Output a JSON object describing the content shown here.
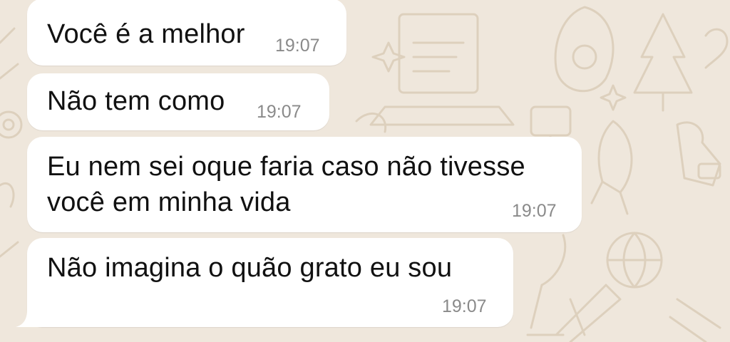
{
  "chat": {
    "messages": [
      {
        "text": "Você é a melhor",
        "time": "19:07"
      },
      {
        "text": "Não tem como",
        "time": "19:07"
      },
      {
        "lines": [
          "Eu nem sei oque faria caso não tivesse",
          "você em minha vida"
        ],
        "time": "19:07"
      },
      {
        "text": "Não imagina o quão grato eu sou",
        "time": "19:07"
      }
    ]
  },
  "colors": {
    "wallpaper": "#efe7dc",
    "doodle": "#ddd0bd",
    "bubble": "#ffffff",
    "text": "#111111",
    "timestamp": "#8a8a8a"
  }
}
